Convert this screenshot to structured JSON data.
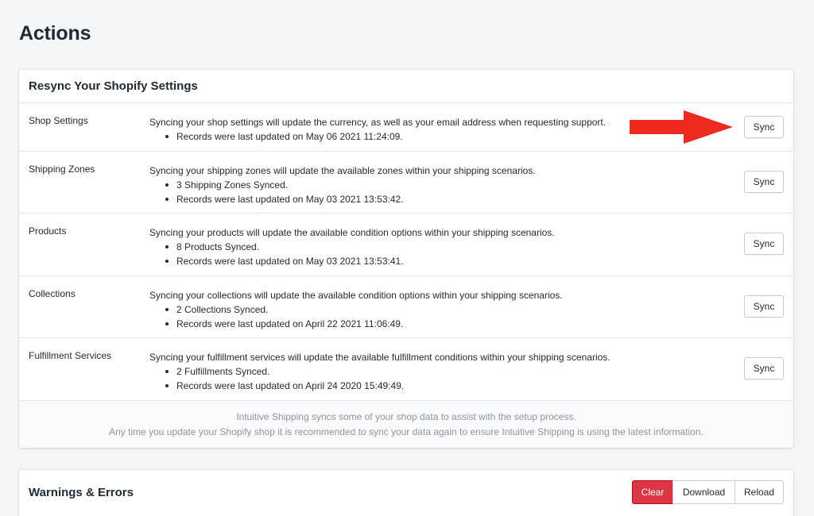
{
  "page": {
    "title": "Actions"
  },
  "resync": {
    "title": "Resync Your Shopify Settings",
    "button_label": "Sync",
    "rows": [
      {
        "label": "Shop Settings",
        "description": "Syncing your shop settings will update the currency, as well as your email address when requesting support.",
        "bullets": [
          "Records were last updated on May 06 2021 11:24:09."
        ]
      },
      {
        "label": "Shipping Zones",
        "description": "Syncing your shipping zones will update the available zones within your shipping scenarios.",
        "bullets": [
          "3 Shipping Zones Synced.",
          "Records were last updated on May 03 2021 13:53:42."
        ]
      },
      {
        "label": "Products",
        "description": "Syncing your products will update the available condition options within your shipping scenarios.",
        "bullets": [
          "8 Products Synced.",
          "Records were last updated on May 03 2021 13:53:41."
        ]
      },
      {
        "label": "Collections",
        "description": "Syncing your collections will update the available condition options within your shipping scenarios.",
        "bullets": [
          "2 Collections Synced.",
          "Records were last updated on April 22 2021 11:06:49."
        ]
      },
      {
        "label": "Fulfillment Services",
        "description": "Syncing your fulfillment services will update the available fulfillment conditions within your shipping scenarios.",
        "bullets": [
          "2 Fulfillments Synced.",
          "Records were last updated on April 24 2020 15:49:49."
        ]
      }
    ],
    "footer_line1": "Intuitive Shipping syncs some of your shop data to assist with the setup process.",
    "footer_line2": "Any time you update your Shopify shop it is recommended to sync your data again to ensure Intuitive Shipping is using the latest information."
  },
  "warnings": {
    "title": "Warnings & Errors",
    "clear_label": "Clear",
    "download_label": "Download",
    "reload_label": "Reload"
  },
  "colors": {
    "arrow": "#ee2a1f",
    "danger": "#de3545"
  }
}
